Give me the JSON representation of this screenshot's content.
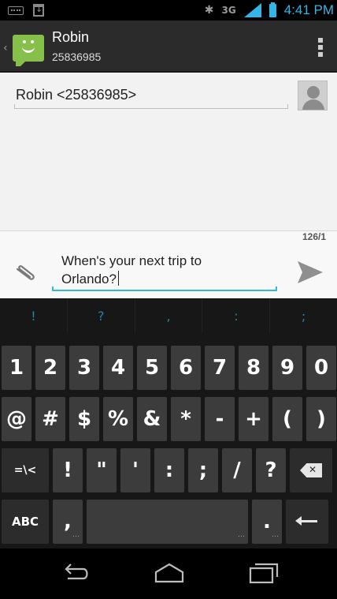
{
  "status_bar": {
    "clock": "4:41 PM",
    "network_type": "3G",
    "icons": [
      "keyboard-icon",
      "download-icon",
      "bluetooth-icon",
      "network-3g-icon",
      "signal-icon",
      "battery-icon"
    ]
  },
  "action_bar": {
    "contact_name": "Robin",
    "contact_number": "25836985",
    "icons": [
      "up-caret-icon",
      "messaging-app-icon",
      "overflow-menu-icon"
    ]
  },
  "recipient": {
    "text": "Robin <25836985>",
    "avatar_icon": "contact-avatar-icon"
  },
  "compose": {
    "counter": "126/1",
    "message": "When's your next trip to\nOrlando?",
    "attach_icon": "paperclip-icon",
    "send_icon": "send-icon"
  },
  "keyboard": {
    "suggestions": [
      "!",
      "?",
      ",",
      ":",
      ";"
    ],
    "row_numbers": [
      "1",
      "2",
      "3",
      "4",
      "5",
      "6",
      "7",
      "8",
      "9",
      "0"
    ],
    "row_symbols1": [
      "@",
      "#",
      "$",
      "%",
      "&",
      "*",
      "-",
      "+",
      "(",
      ")"
    ],
    "row_symbols2": [
      "=\\<",
      "!",
      "\"",
      "'",
      ":",
      ";",
      "/",
      "?"
    ],
    "row_bottom": {
      "abc": "ABC",
      "comma": ",",
      "comma_sub": "…",
      "space_sub": "…",
      "period": ".",
      "period_sub": "…"
    }
  },
  "nav_bar": {
    "icons": [
      "back-icon",
      "home-icon",
      "recent-apps-icon"
    ]
  },
  "colors": {
    "accent": "#33b5e5",
    "app_green": "#86c04a",
    "action_bar": "#2b2b2b",
    "keyboard_bg": "#171717",
    "key_bg": "#3c3c3c"
  }
}
